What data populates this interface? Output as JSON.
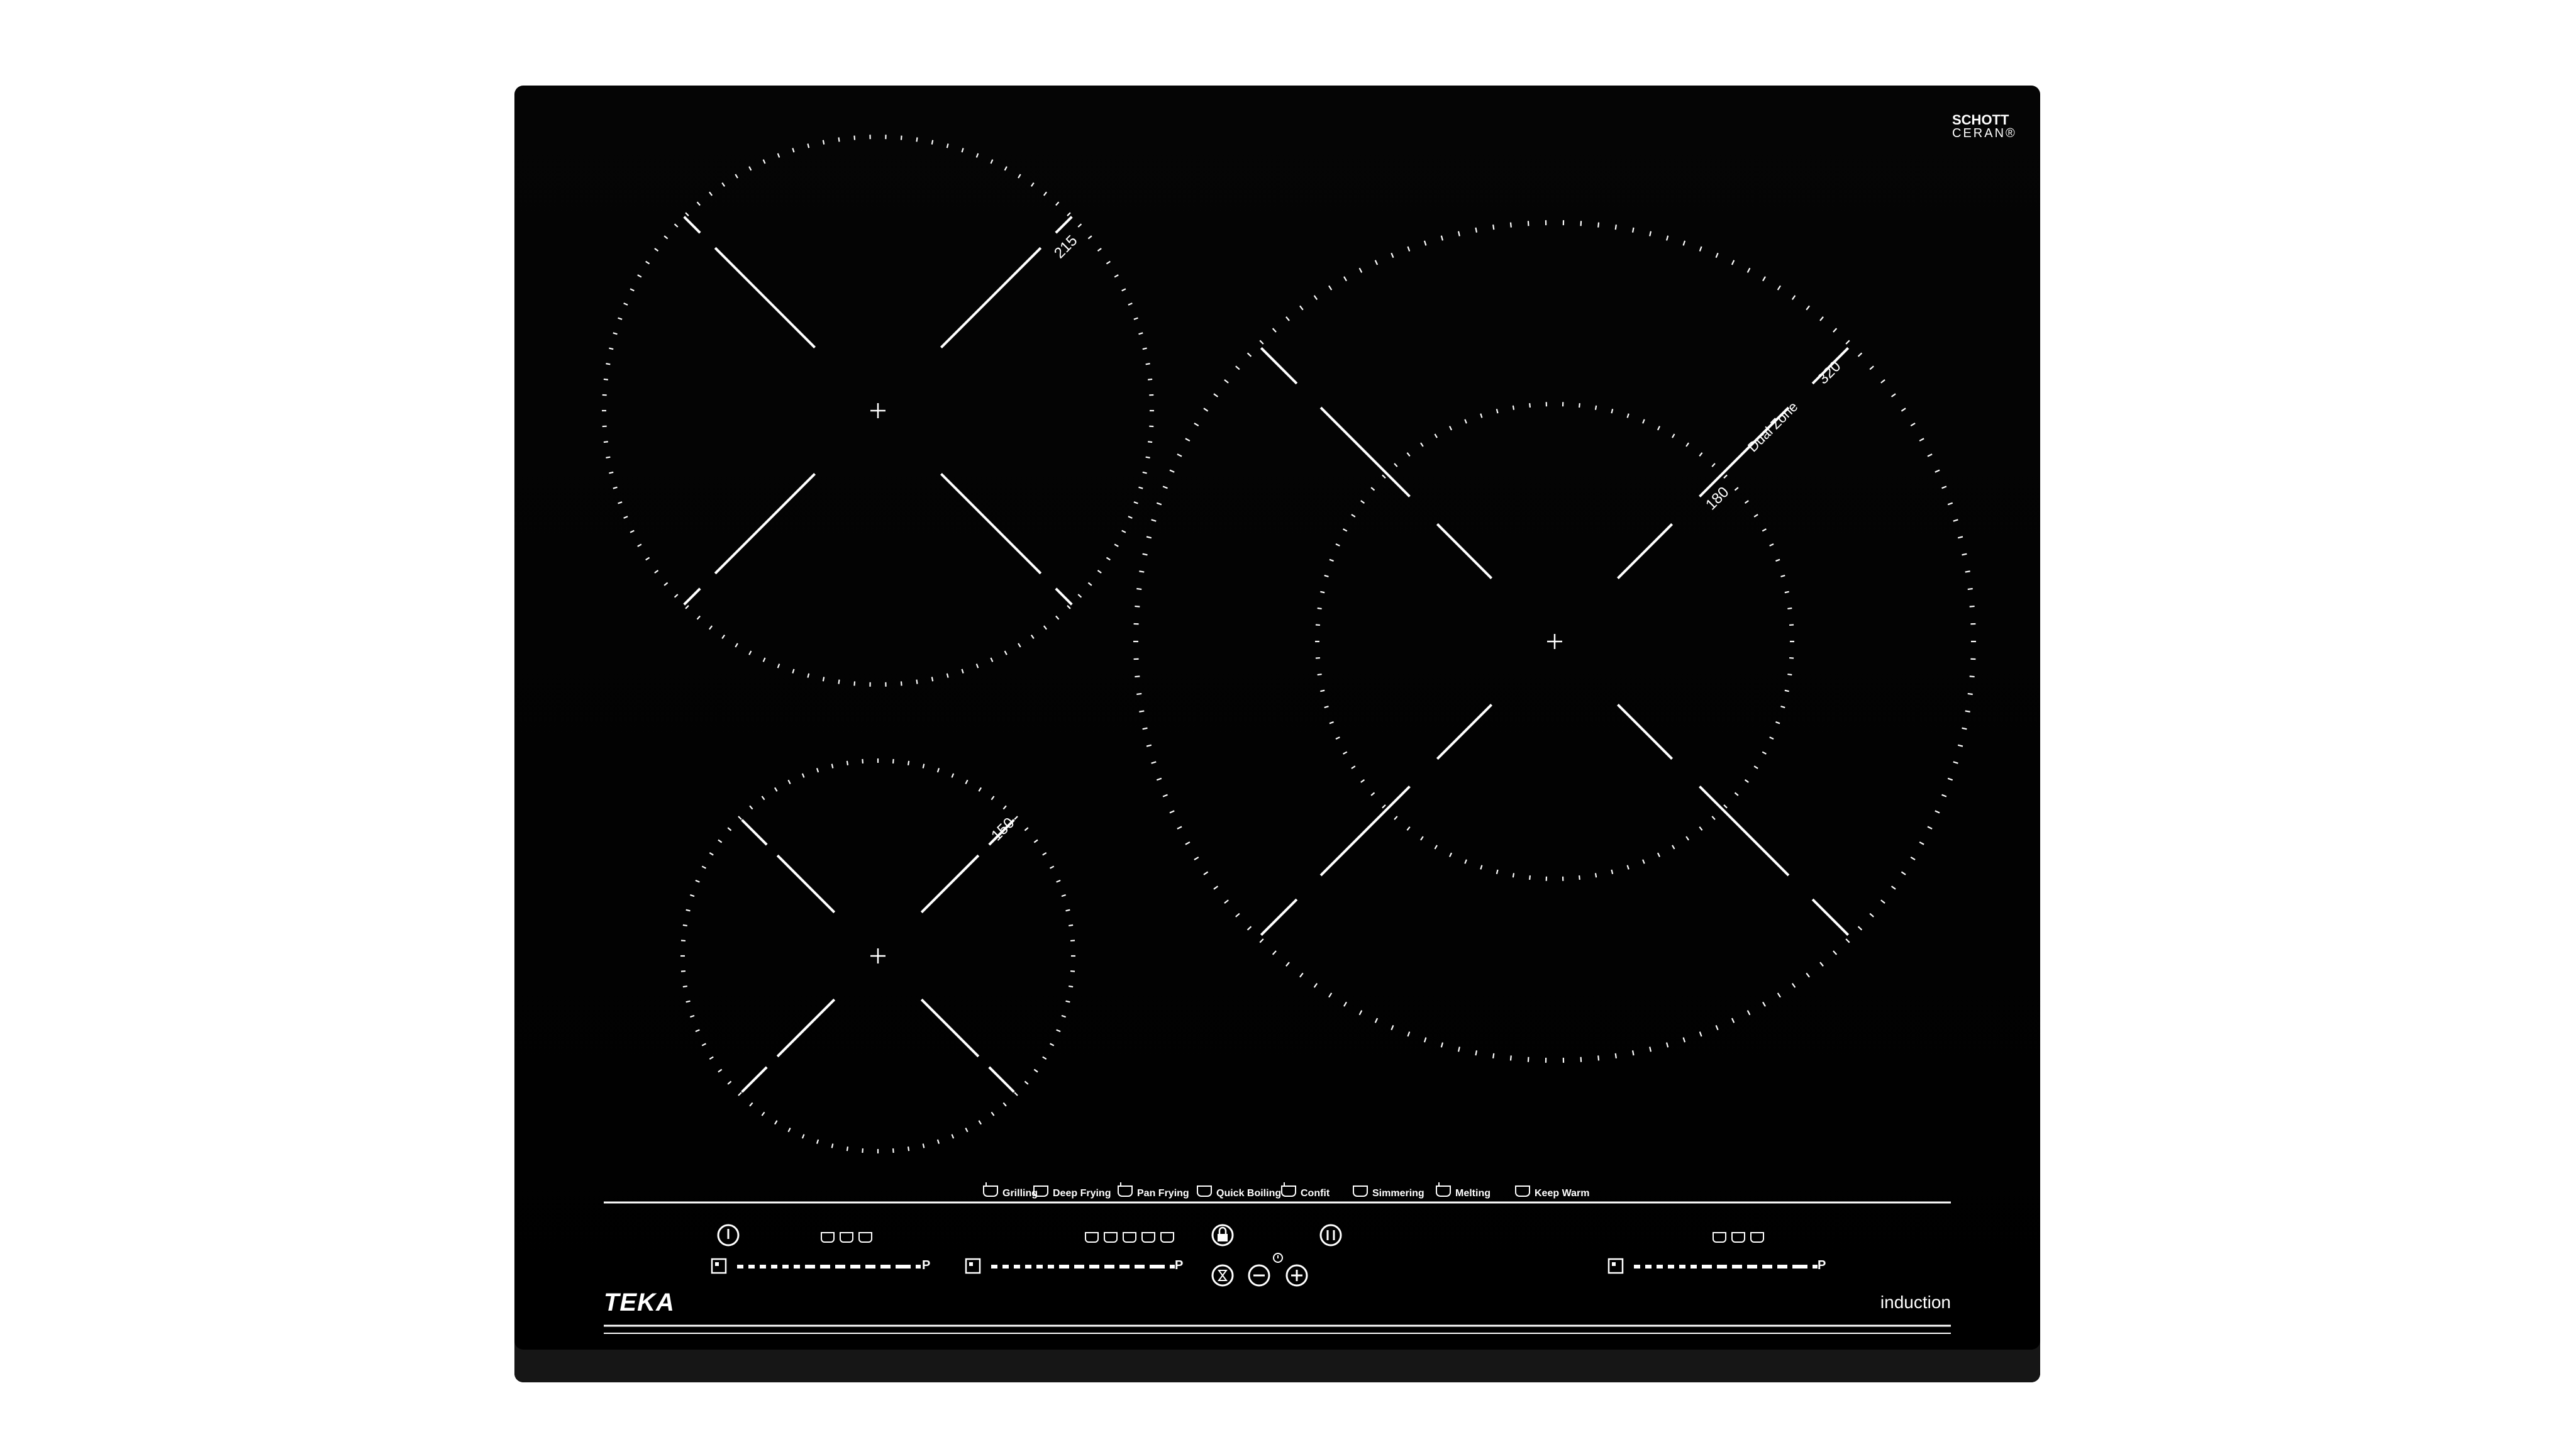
{
  "brand": {
    "logo_text": "TEKA",
    "induction_label": "induction",
    "glass_logo_line1": "SCHOTT",
    "glass_logo_line2": "CERAN®"
  },
  "zones": {
    "top_left": {
      "size_label": "215"
    },
    "bottom_left": {
      "size_label": "150"
    },
    "right": {
      "outer_label": "320",
      "inner_label": "180",
      "dual_label": "Dual Zone"
    }
  },
  "functions": {
    "items": [
      {
        "label": "Grilling",
        "icon": "grill-icon"
      },
      {
        "label": "Deep Frying",
        "icon": "deep-fry-icon"
      },
      {
        "label": "Pan Frying",
        "icon": "pan-icon"
      },
      {
        "label": "Quick Boiling",
        "icon": "boil-icon"
      },
      {
        "label": "Confit",
        "icon": "confit-icon"
      },
      {
        "label": "Simmering",
        "icon": "pot-icon"
      },
      {
        "label": "Melting",
        "icon": "melt-icon"
      },
      {
        "label": "Keep Warm",
        "icon": "keep-warm-icon"
      }
    ]
  },
  "controls": {
    "slider_max_label": "P",
    "power_icon": "power-icon",
    "pause_icon": "pause-icon",
    "lock_icon": "lock-icon",
    "timer_icon": "timer-icon",
    "minus_icon": "minus-icon",
    "plus_icon": "plus-icon"
  },
  "colors": {
    "glass": "#000000",
    "print": "#ffffff",
    "page": "#ffffff"
  }
}
